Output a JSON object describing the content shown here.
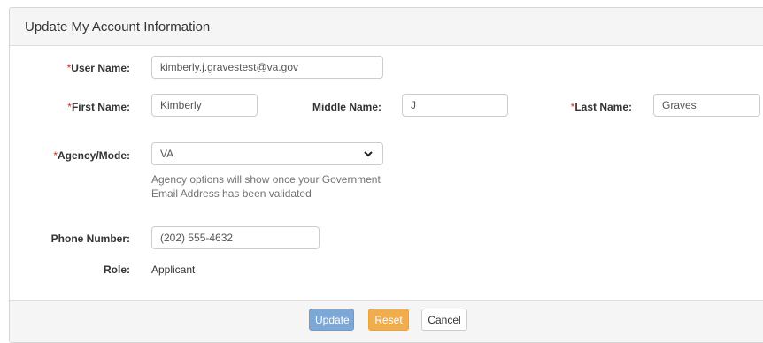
{
  "panel": {
    "title": "Update My Account Information"
  },
  "form": {
    "required_mark": "*",
    "user_name": {
      "label": "User Name:",
      "value": "kimberly.j.gravestest@va.gov"
    },
    "first_name": {
      "label": "First Name:",
      "value": "Kimberly"
    },
    "middle_name": {
      "label": "Middle Name:",
      "value": "J"
    },
    "last_name": {
      "label": "Last Name:",
      "value": "Graves"
    },
    "agency": {
      "label": "Agency/Mode:",
      "selected": "VA",
      "help": "Agency options will show once your Government Email Address has been validated"
    },
    "phone": {
      "label": "Phone Number:",
      "value": "(202) 555-4632"
    },
    "role": {
      "label": "Role:",
      "value": "Applicant"
    }
  },
  "footer": {
    "update_label": "Update",
    "reset_label": "Reset",
    "cancel_label": "Cancel"
  },
  "colors": {
    "update_button": "#7da7d4",
    "reset_button": "#f0ad4e",
    "required_marker": "#c9302c"
  },
  "icons": {
    "select_caret": "chevron-down-icon"
  }
}
